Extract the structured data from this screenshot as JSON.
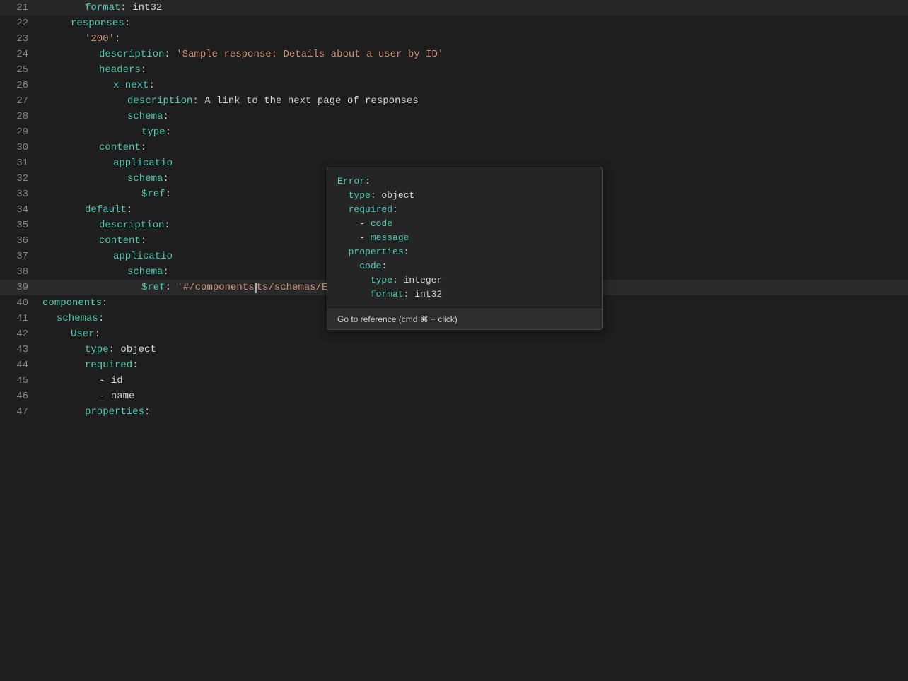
{
  "editor": {
    "lines": [
      {
        "num": "21",
        "indent": 3,
        "content": [
          {
            "type": "key",
            "text": "format"
          },
          {
            "type": "plain",
            "text": ": "
          },
          {
            "type": "plain",
            "text": "int32"
          }
        ]
      },
      {
        "num": "22",
        "indent": 2,
        "content": [
          {
            "type": "key",
            "text": "responses"
          },
          {
            "type": "plain",
            "text": ":"
          }
        ]
      },
      {
        "num": "23",
        "indent": 3,
        "content": [
          {
            "type": "string",
            "text": "'200'"
          },
          {
            "type": "plain",
            "text": ":"
          }
        ]
      },
      {
        "num": "24",
        "indent": 4,
        "content": [
          {
            "type": "key",
            "text": "description"
          },
          {
            "type": "plain",
            "text": ": "
          },
          {
            "type": "string",
            "text": "'Sample response: Details about a user by ID'"
          }
        ]
      },
      {
        "num": "25",
        "indent": 4,
        "content": [
          {
            "type": "key",
            "text": "headers"
          },
          {
            "type": "plain",
            "text": ":"
          }
        ]
      },
      {
        "num": "26",
        "indent": 5,
        "content": [
          {
            "type": "key",
            "text": "x-next"
          },
          {
            "type": "plain",
            "text": ":"
          }
        ]
      },
      {
        "num": "27",
        "indent": 6,
        "content": [
          {
            "type": "key",
            "text": "description"
          },
          {
            "type": "plain",
            "text": ": A link to the next page of responses"
          }
        ]
      },
      {
        "num": "28",
        "indent": 6,
        "content": [
          {
            "type": "key",
            "text": "schema"
          },
          {
            "type": "plain",
            "text": ":"
          }
        ]
      },
      {
        "num": "29",
        "indent": 7,
        "content": [
          {
            "type": "key",
            "text": "type"
          },
          {
            "type": "plain",
            "text": ":"
          }
        ]
      },
      {
        "num": "30",
        "indent": 4,
        "content": [
          {
            "type": "key",
            "text": "content"
          },
          {
            "type": "plain",
            "text": ":"
          }
        ]
      },
      {
        "num": "31",
        "indent": 5,
        "content": [
          {
            "type": "key",
            "text": "applicatio"
          },
          {
            "type": "plain",
            "text": ""
          }
        ]
      },
      {
        "num": "32",
        "indent": 6,
        "content": [
          {
            "type": "key",
            "text": "schema"
          },
          {
            "type": "plain",
            "text": ":"
          }
        ]
      },
      {
        "num": "33",
        "indent": 7,
        "content": [
          {
            "type": "key",
            "text": "$ref"
          },
          {
            "type": "plain",
            "text": ":"
          }
        ]
      },
      {
        "num": "34",
        "indent": 3,
        "content": [
          {
            "type": "key",
            "text": "default"
          },
          {
            "type": "plain",
            "text": ":"
          }
        ]
      },
      {
        "num": "35",
        "indent": 4,
        "content": [
          {
            "type": "key",
            "text": "description"
          },
          {
            "type": "plain",
            "text": ":"
          }
        ]
      },
      {
        "num": "36",
        "indent": 4,
        "content": [
          {
            "type": "key",
            "text": "content"
          },
          {
            "type": "plain",
            "text": ":"
          }
        ]
      },
      {
        "num": "37",
        "indent": 5,
        "content": [
          {
            "type": "key",
            "text": "applicatio"
          },
          {
            "type": "plain",
            "text": ""
          }
        ]
      },
      {
        "num": "38",
        "indent": 6,
        "content": [
          {
            "type": "key",
            "text": "schema"
          },
          {
            "type": "plain",
            "text": ":"
          }
        ]
      },
      {
        "num": "39",
        "indent": 7,
        "content": [
          {
            "type": "key",
            "text": "$ref"
          },
          {
            "type": "plain",
            "text": ": "
          },
          {
            "type": "string",
            "text": "'#/components/schemas/Error'"
          }
        ],
        "highlight": true
      },
      {
        "num": "40",
        "indent": 0,
        "content": [
          {
            "type": "key",
            "text": "components"
          },
          {
            "type": "plain",
            "text": ":"
          }
        ]
      },
      {
        "num": "41",
        "indent": 1,
        "content": [
          {
            "type": "key",
            "text": "schemas"
          },
          {
            "type": "plain",
            "text": ":"
          }
        ]
      },
      {
        "num": "42",
        "indent": 2,
        "content": [
          {
            "type": "key",
            "text": "User"
          },
          {
            "type": "plain",
            "text": ":"
          }
        ]
      },
      {
        "num": "43",
        "indent": 3,
        "content": [
          {
            "type": "key",
            "text": "type"
          },
          {
            "type": "plain",
            "text": ": "
          },
          {
            "type": "plain",
            "text": "object"
          }
        ]
      },
      {
        "num": "44",
        "indent": 3,
        "content": [
          {
            "type": "key",
            "text": "required"
          },
          {
            "type": "plain",
            "text": ":"
          }
        ]
      },
      {
        "num": "45",
        "indent": 4,
        "content": [
          {
            "type": "plain",
            "text": "- "
          },
          {
            "type": "plain",
            "text": "id"
          }
        ]
      },
      {
        "num": "46",
        "indent": 4,
        "content": [
          {
            "type": "plain",
            "text": "- "
          },
          {
            "type": "plain",
            "text": "name"
          }
        ]
      },
      {
        "num": "47",
        "indent": 3,
        "content": [
          {
            "type": "key",
            "text": "properties"
          },
          {
            "type": "plain",
            "text": ":"
          }
        ]
      }
    ],
    "tooltip": {
      "code_lines": [
        {
          "indent": 0,
          "content": [
            {
              "type": "key",
              "text": "Error"
            },
            {
              "type": "plain",
              "text": ":"
            }
          ]
        },
        {
          "indent": 1,
          "content": [
            {
              "type": "key",
              "text": "type"
            },
            {
              "type": "plain",
              "text": ": object"
            }
          ]
        },
        {
          "indent": 1,
          "content": [
            {
              "type": "key",
              "text": "required"
            },
            {
              "type": "plain",
              "text": ":"
            }
          ]
        },
        {
          "indent": 2,
          "content": [
            {
              "type": "plain",
              "text": "- "
            },
            {
              "type": "key",
              "text": "code"
            }
          ]
        },
        {
          "indent": 2,
          "content": [
            {
              "type": "plain",
              "text": "- "
            },
            {
              "type": "key",
              "text": "message"
            }
          ]
        },
        {
          "indent": 1,
          "content": [
            {
              "type": "key",
              "text": "properties"
            },
            {
              "type": "plain",
              "text": ":"
            }
          ]
        },
        {
          "indent": 2,
          "content": [
            {
              "type": "key",
              "text": "code"
            },
            {
              "type": "plain",
              "text": ":"
            }
          ]
        },
        {
          "indent": 3,
          "content": [
            {
              "type": "key",
              "text": "type"
            },
            {
              "type": "plain",
              "text": ": integer"
            }
          ]
        },
        {
          "indent": 3,
          "content": [
            {
              "type": "key",
              "text": "format"
            },
            {
              "type": "plain",
              "text": ": int32"
            }
          ]
        }
      ],
      "action": "Go to reference (cmd ⌘ + click)"
    }
  }
}
